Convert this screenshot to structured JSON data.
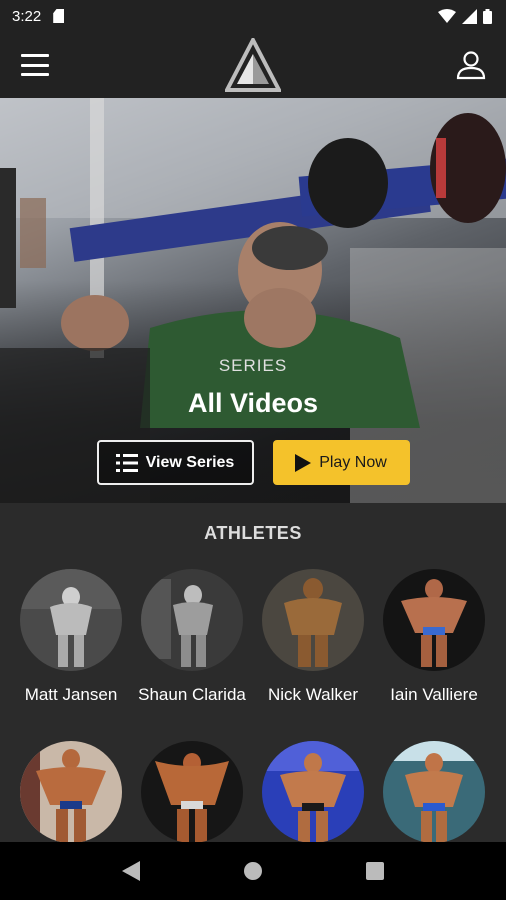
{
  "status_bar": {
    "time": "3:22"
  },
  "app_bar": {
    "menu_icon": "hamburger-icon",
    "logo_icon": "triangle-logo",
    "profile_icon": "user-icon"
  },
  "hero": {
    "eyebrow": "SERIES",
    "title": "All Videos",
    "view_series_label": "View Series",
    "play_now_label": "Play Now",
    "accent_color": "#f4c22b"
  },
  "athletes": {
    "title": "ATHLETES",
    "items": [
      {
        "name": "Matt Jansen"
      },
      {
        "name": "Shaun Clarida"
      },
      {
        "name": "Nick Walker"
      },
      {
        "name": "Iain Valliere"
      },
      {
        "name": ""
      },
      {
        "name": ""
      },
      {
        "name": ""
      },
      {
        "name": ""
      }
    ]
  },
  "nav_bar": {
    "back_icon": "back-triangle-icon",
    "home_icon": "home-circle-icon",
    "recents_icon": "recents-square-icon"
  }
}
